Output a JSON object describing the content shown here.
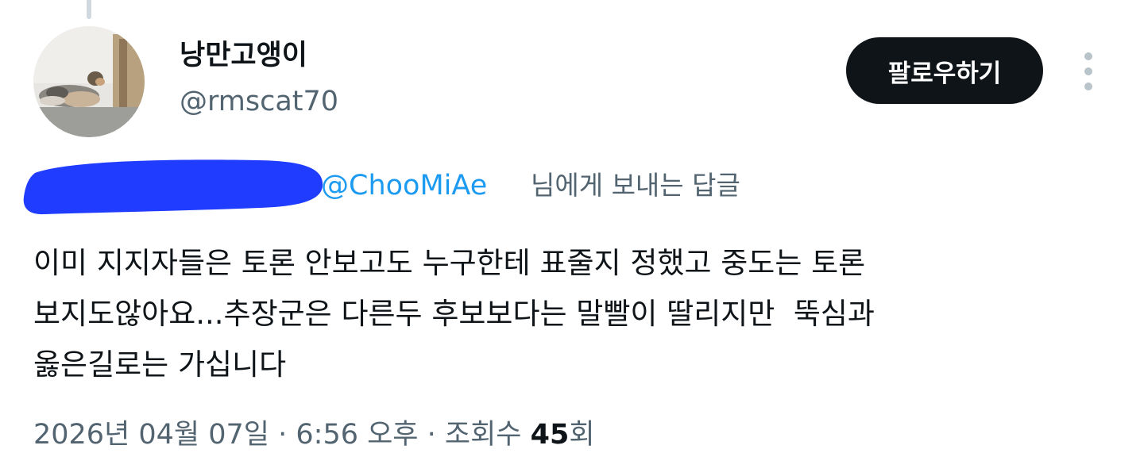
{
  "user": {
    "display_name": "낭만고앵이",
    "handle": "@rmscat70"
  },
  "actions": {
    "follow_label": "팔로우하기",
    "more_icon": "vertical-ellipsis-icon"
  },
  "reply_context": {
    "mention": "@ChooMiAe",
    "suffix": "님에게 보내는 답글",
    "redaction_color": "#1f3cff"
  },
  "tweet": {
    "lines": [
      "이미 지지자들은 토론 안보고도 누구한테 표줄지 정했고 중도는 토론",
      "보지도않아요...추장군은 다른두 후보보다는 말빨이 딸리지만  뚝심과",
      "옳은길로는 가십니다"
    ]
  },
  "meta": {
    "date": "2026년 04월 07일",
    "separator": " · ",
    "time": "6:56 오후",
    "views_label": "조회수",
    "views_count": "45",
    "views_unit": "회"
  },
  "colors": {
    "text_primary": "#0f1419",
    "text_secondary": "#536471",
    "link": "#1d9bf0",
    "button_bg": "#0f1419"
  }
}
